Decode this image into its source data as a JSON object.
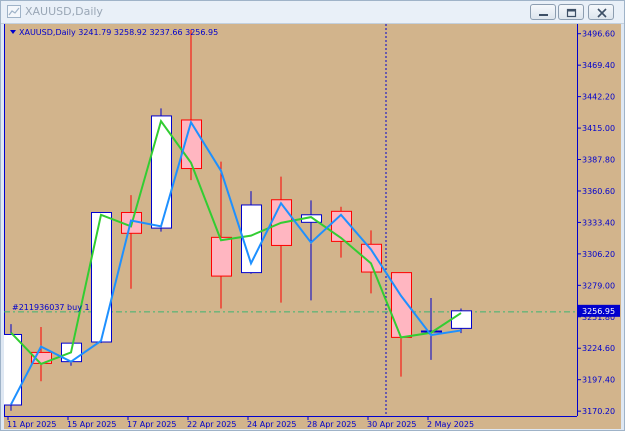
{
  "window": {
    "title": "XAUUSD,Daily",
    "buttons": {
      "minimize": "minimize-icon",
      "maximize": "maximize-icon",
      "close": "close-icon"
    }
  },
  "chart": {
    "header": "XAUUSD,Daily  3241.79 3258.92 3237.66 3256.95",
    "order_label": "#211936037 buy 1",
    "price_tag": "3256.95"
  },
  "colors": {
    "background": "#d2b48c",
    "bull_fill": "#ffffff",
    "bull_border": "#0000cd",
    "bear_fill": "#ffb6c1",
    "bear_border": "#ff0000",
    "line_fast": "#32cd32",
    "line_slow": "#1e90ff",
    "axis_text": "#0000cd",
    "order_line": "#3cb371",
    "price_tag_bg": "#0000cd"
  },
  "chart_data": {
    "type": "candlestick",
    "title": "XAUUSD,Daily",
    "ylim": [
      3166,
      3505
    ],
    "y_ticks": [
      "3496.60",
      "3469.40",
      "3442.20",
      "3415.00",
      "3387.80",
      "3360.60",
      "3333.40",
      "3306.20",
      "3279.00",
      "3251.80",
      "3224.60",
      "3197.40",
      "3170.20"
    ],
    "x_ticks": [
      {
        "index": 0,
        "label": "11 Apr 2025"
      },
      {
        "index": 2,
        "label": "15 Apr 2025"
      },
      {
        "index": 4,
        "label": "17 Apr 2025"
      },
      {
        "index": 6,
        "label": "22 Apr 2025"
      },
      {
        "index": 8,
        "label": "24 Apr 2025"
      },
      {
        "index": 10,
        "label": "28 Apr 2025"
      },
      {
        "index": 12,
        "label": "30 Apr 2025"
      },
      {
        "index": 14,
        "label": "2 May 2025"
      }
    ],
    "candles": [
      {
        "open": 3175.5,
        "high": 3245.5,
        "low": 3170.5,
        "close": 3236.5
      },
      {
        "open": 3221.0,
        "high": 3243.0,
        "low": 3196.0,
        "close": 3211.5
      },
      {
        "open": 3213.0,
        "high": 3229.0,
        "low": 3209.5,
        "close": 3229.0
      },
      {
        "open": 3230.0,
        "high": 3342.0,
        "low": 3229.0,
        "close": 3342.0
      },
      {
        "open": 3342.0,
        "high": 3357.0,
        "low": 3276.0,
        "close": 3324.0
      },
      {
        "open": 3328.5,
        "high": 3432.0,
        "low": 3325.5,
        "close": 3425.5
      },
      {
        "open": 3422.0,
        "high": 3500.0,
        "low": 3370.0,
        "close": 3380.0
      },
      {
        "open": 3320.5,
        "high": 3386.0,
        "low": 3259.0,
        "close": 3287.0
      },
      {
        "open": 3290.0,
        "high": 3360.5,
        "low": 3289.0,
        "close": 3348.5
      },
      {
        "open": 3353.0,
        "high": 3373.0,
        "low": 3264.0,
        "close": 3313.5
      },
      {
        "open": 3333.5,
        "high": 3352.5,
        "low": 3266.0,
        "close": 3340.0
      },
      {
        "open": 3343.0,
        "high": 3347.0,
        "low": 3303.0,
        "close": 3317.0
      },
      {
        "open": 3314.5,
        "high": 3326.5,
        "low": 3272.0,
        "close": 3290.5
      },
      {
        "open": 3290.0,
        "high": 3290.0,
        "low": 3200.0,
        "close": 3234.0
      },
      {
        "open": 3239.5,
        "high": 3268.0,
        "low": 3214.5,
        "close": 3239.5
      },
      {
        "open": 3241.79,
        "high": 3258.92,
        "low": 3237.66,
        "close": 3256.95
      }
    ],
    "series": [
      {
        "values": [
          3238.0,
          3211.0,
          3221.0,
          3340.0,
          3330.0,
          3421.0,
          3385.0,
          3318.0,
          3322.0,
          3333.0,
          3338.0,
          3320.0,
          3298.0,
          3234.0,
          3238.0,
          3255.0
        ]
      },
      {
        "values": [
          3176.0,
          3226.0,
          3213.0,
          3231.0,
          3335.0,
          3330.0,
          3420.0,
          3378.0,
          3298.0,
          3350.0,
          3316.0,
          3340.0,
          3310.0,
          3270.0,
          3236.0,
          3240.0
        ]
      }
    ],
    "order_line_price": 3256.0,
    "current_price": 3256.95,
    "vline_index": 12.5
  }
}
